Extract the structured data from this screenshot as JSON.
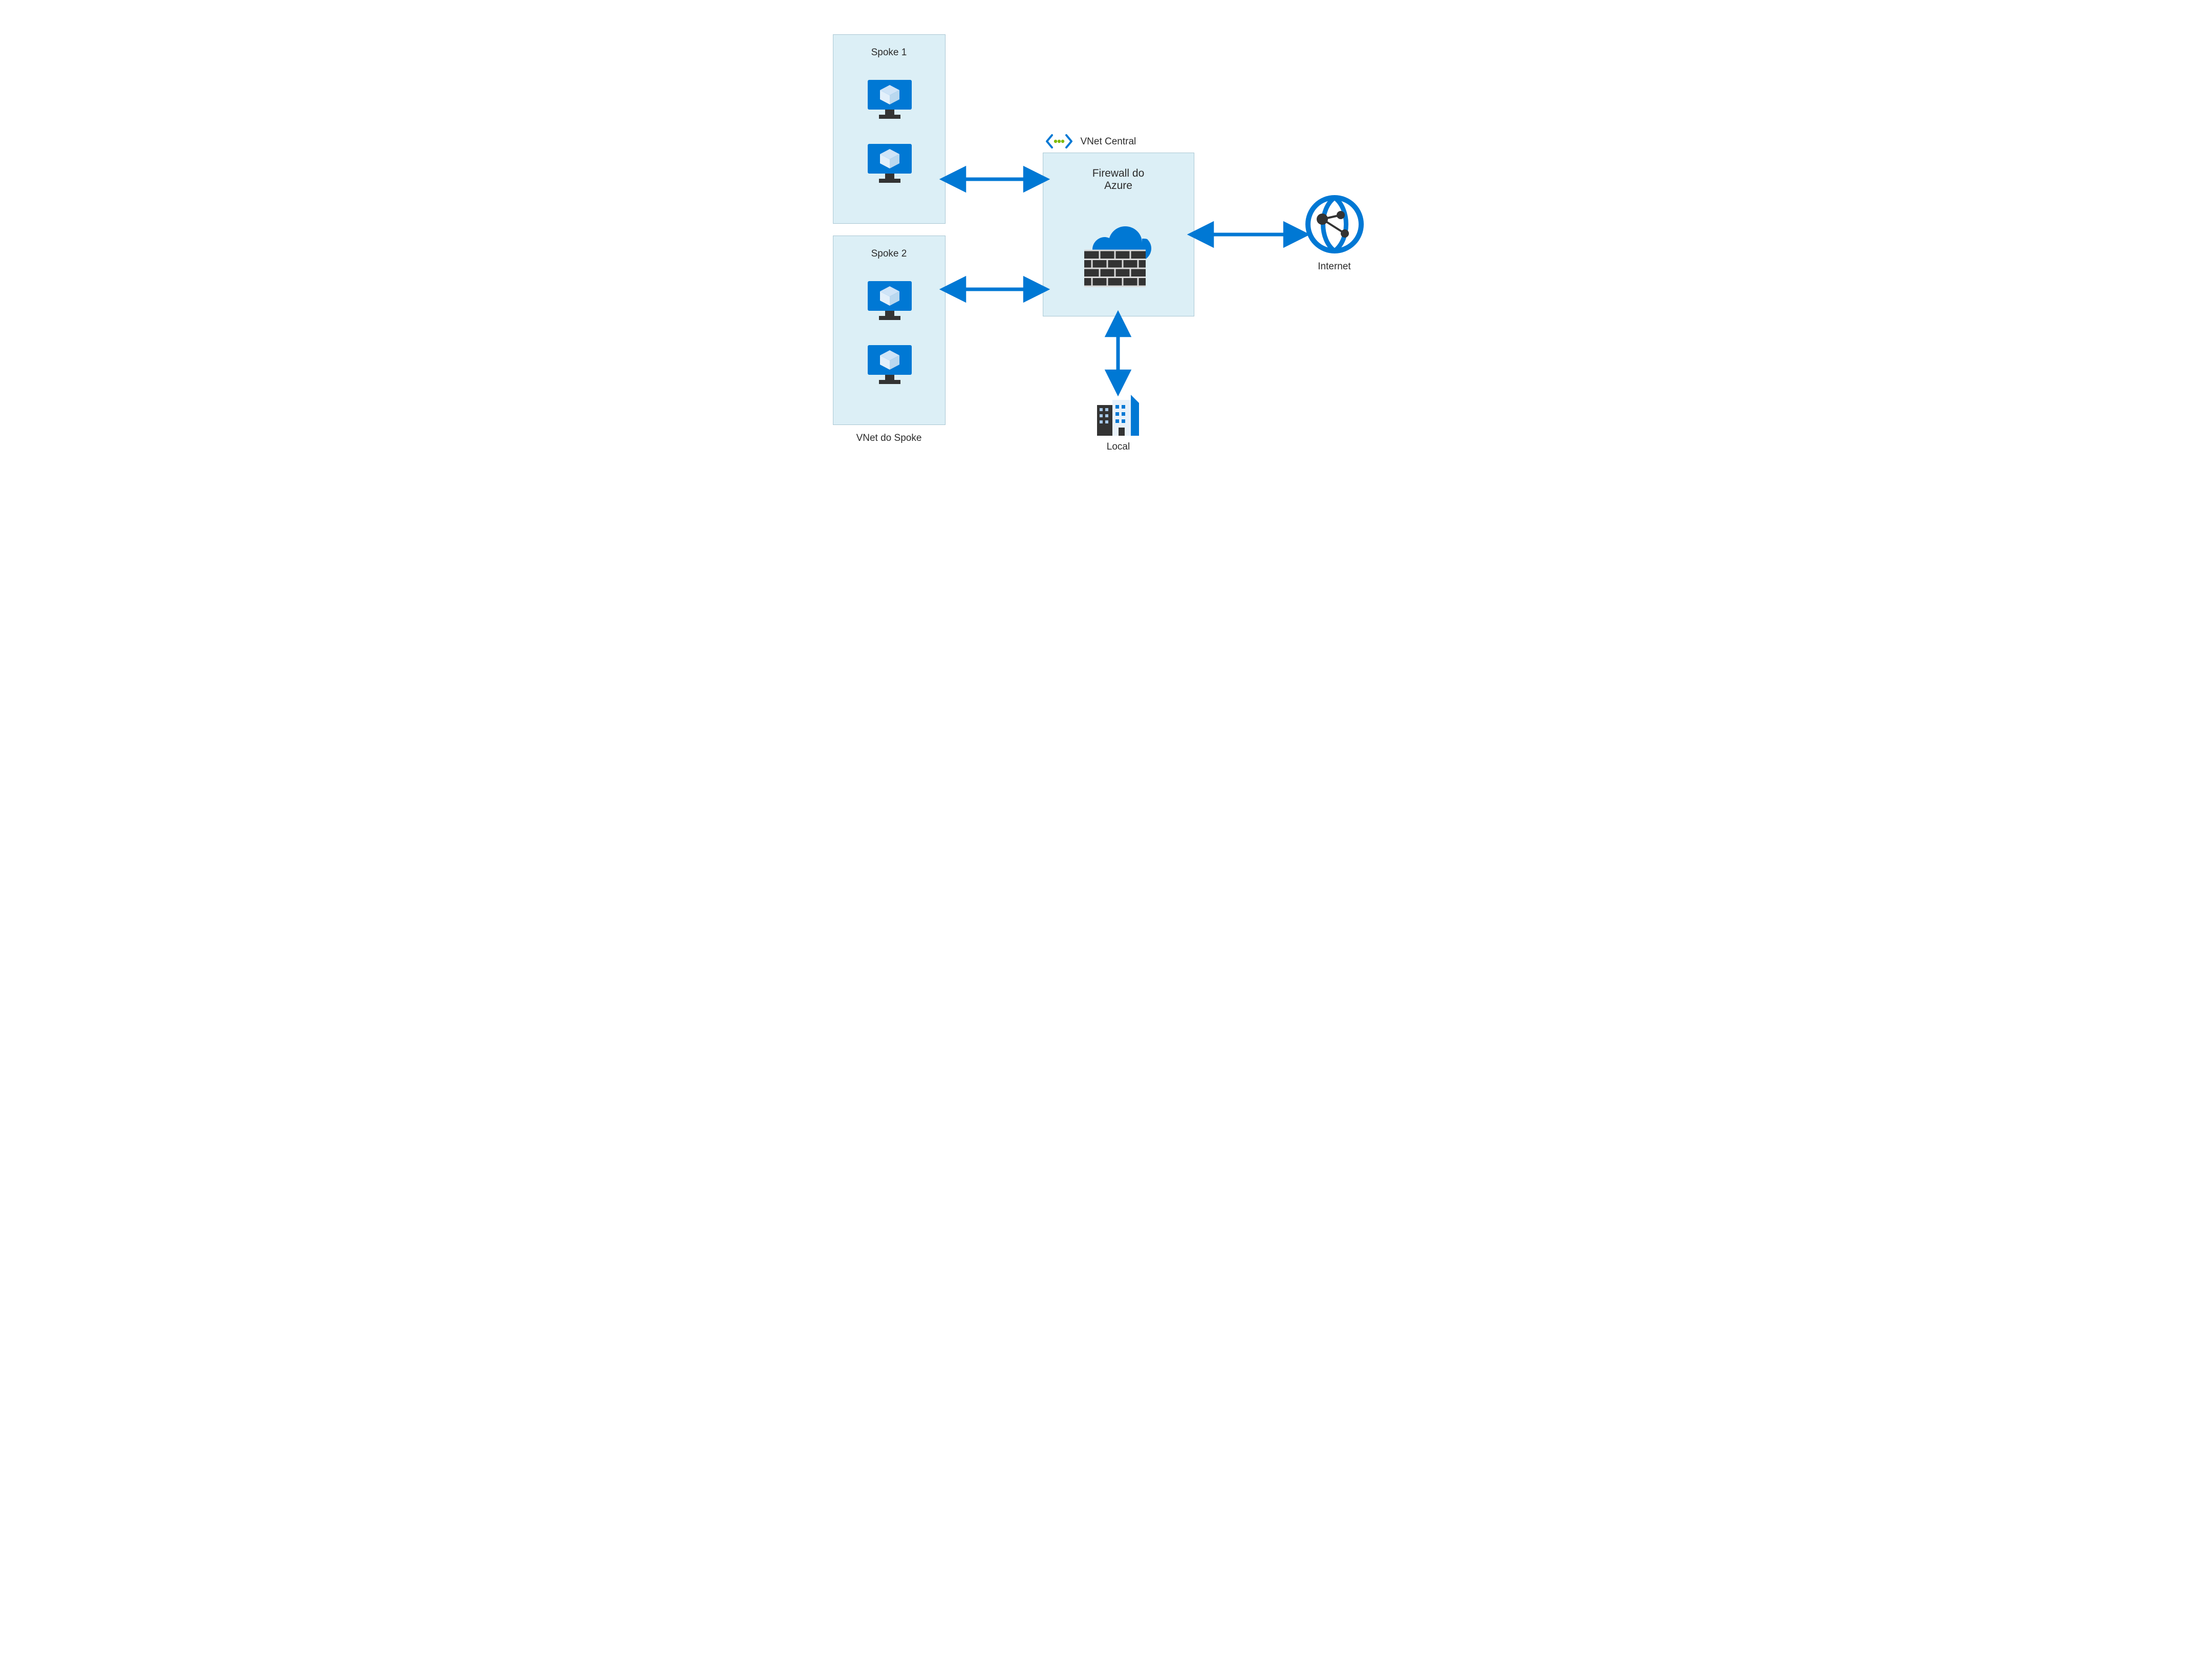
{
  "spoke1": {
    "title": "Spoke 1"
  },
  "spoke2": {
    "title": "Spoke 2"
  },
  "spoke_vnet_label": "VNet do Spoke",
  "hub": {
    "vnet_label": "VNet Central",
    "title": "Firewall do\nAzure"
  },
  "onprem": {
    "label": "Local"
  },
  "internet": {
    "label": "Internet"
  },
  "colors": {
    "azure_blue": "#0078d4",
    "dark": "#333333",
    "green": "#7fba00"
  }
}
